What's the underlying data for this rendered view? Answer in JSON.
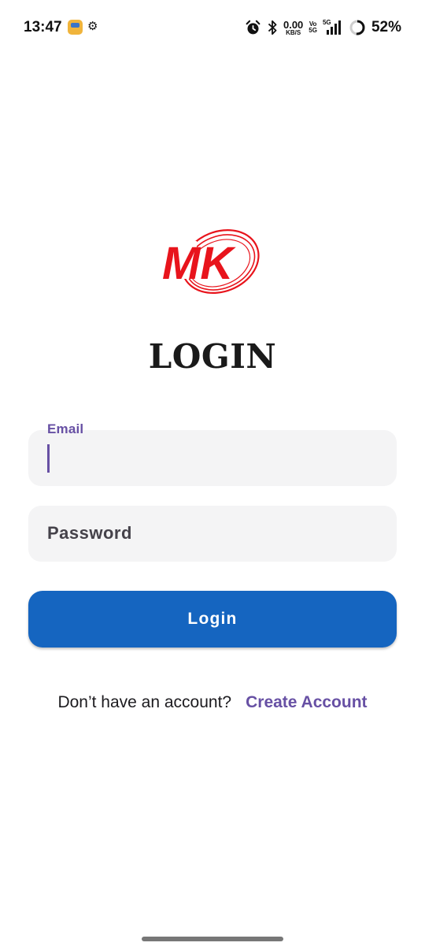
{
  "status_bar": {
    "time": "13:47",
    "net_speed_value": "0.00",
    "net_speed_unit": "KB/S",
    "volte_top": "Vo",
    "volte_bottom": "5G",
    "signal_label": "5G",
    "battery_percent": "52%",
    "icons": [
      "app-notification-icon",
      "settings-notification-icon",
      "alarm-icon",
      "bluetooth-icon",
      "signal-icon",
      "battery-icon"
    ]
  },
  "logo": {
    "text": "MK",
    "color": "#e8141c"
  },
  "title": "LOGIN",
  "form": {
    "email_label": "Email",
    "email_value": "",
    "password_placeholder": "Password",
    "login_label": "Login"
  },
  "signup": {
    "prompt": "Don’t have an account?",
    "link": "Create Account"
  },
  "colors": {
    "primary": "#1565c0",
    "accent": "#6750a4",
    "field_bg": "#f4f4f5",
    "logo_red": "#e8141c"
  }
}
